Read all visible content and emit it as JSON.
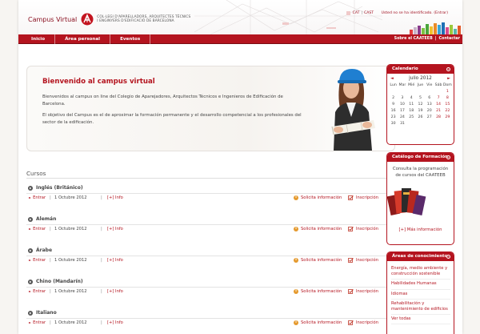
{
  "header": {
    "brand_title": "Campus Virtual",
    "brand_sub_line1": "COL·LEGI D'APARELLADORS, ARQUITECTES TÈCNICS",
    "brand_sub_line2": "I ENGINYERS D'EDIFICACIÓ DE BARCELONA",
    "lang_cat": "CAT",
    "lang_cast": "CAST",
    "user_status": "Usted no se ha identificado. (Entrar)",
    "brand_color": "#b4141f"
  },
  "nav": {
    "items": [
      "Inicio",
      "Área personal",
      "Eventos"
    ],
    "about": "Sobre el CAATEEB",
    "contact": "Contactar"
  },
  "welcome": {
    "title": "Bienvenido al campus virtual",
    "p1": "Bienvenidos al campus on line del Colegio de Aparejadores, Arquitectos Técnicos e Ingenieros de Edificación de Barcelona.",
    "p2": "El objetivo del Campus es el de aproximar la formación permanente y el desarrollo competencial a los profesionales del sector de la edificación."
  },
  "courses": {
    "heading": "Cursos",
    "enter_label": "Entrar",
    "info_label": "[+] Info",
    "solicit_label": "Solicita información",
    "inscr_label": "Inscripción",
    "items": [
      {
        "name": "Inglés (Británico)",
        "date": "1 Octubre 2012"
      },
      {
        "name": "Alemán",
        "date": "1 Octubre 2012"
      },
      {
        "name": "Árabe",
        "date": "1 Octubre 2012"
      },
      {
        "name": "Chino (Mandarín)",
        "date": "1 Octubre 2012"
      },
      {
        "name": "Italiano",
        "date": "1 Octubre 2012"
      }
    ]
  },
  "calendar": {
    "title": "Calendario",
    "month": "julio 2012",
    "prev": "◄",
    "next": "►",
    "days_of_week": [
      "Lun",
      "Mar",
      "Mié",
      "Jue",
      "Vie",
      "Sáb",
      "Dom"
    ],
    "weeks": [
      [
        "",
        "",
        "",
        "",
        "",
        "",
        "1"
      ],
      [
        "2",
        "3",
        "4",
        "5",
        "6",
        "7",
        "8"
      ],
      [
        "9",
        "10",
        "11",
        "12",
        "13",
        "14",
        "15"
      ],
      [
        "16",
        "17",
        "18",
        "19",
        "20",
        "21",
        "22"
      ],
      [
        "23",
        "24",
        "25",
        "26",
        "27",
        "28",
        "29"
      ],
      [
        "30",
        "31",
        "",
        "",
        "",
        "",
        ""
      ]
    ]
  },
  "catalog": {
    "title": "Catálogo de Formación",
    "text": "Consulta la programación de cursos del CAATEEB",
    "more": "[+] Más información"
  },
  "areas": {
    "title": "Áreas de conocimiento",
    "items": [
      "Energía, medio ambiente y construcción sostenible",
      "Habilidades Humanas",
      "Idiomas",
      "Rehabilitación y mantenimiento de edificios",
      "Ver todas"
    ]
  }
}
